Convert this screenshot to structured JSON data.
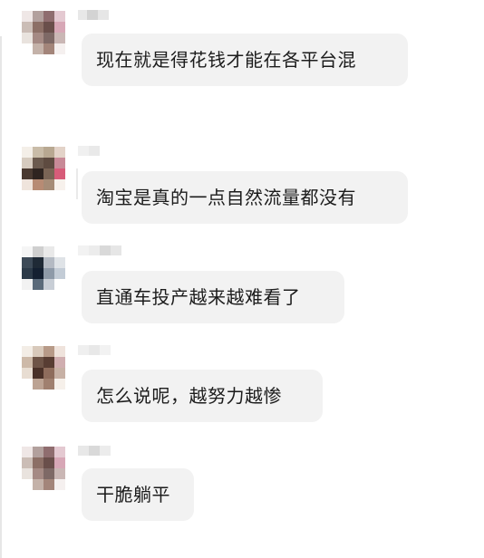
{
  "messages": [
    {
      "text": "现在就是得花钱才能在各平台混"
    },
    {
      "text": "淘宝是真的一点自然流量都没有"
    },
    {
      "text": "直通车投产越来越难看了"
    },
    {
      "text": "怎么说呢，越努力越惨"
    },
    {
      "text": "干脆躺平"
    }
  ],
  "colors": {
    "bubble_bg": "#f2f2f2",
    "text": "#1c1c1c",
    "background": "#ffffff"
  },
  "avatars": [
    {
      "icon": "pixelated-avatar-icon",
      "palette": [
        "#efe7e6",
        "#b2a09d",
        "#8f6d6f",
        "#e4c9d1",
        "#cbbdb6",
        "#8c6f66",
        "#6a4f4b",
        "#d7a7b6",
        "#e9e3de",
        "#a58a84",
        "#7e6966",
        "#cab7b5",
        "#ffffff",
        "#c4b2a9",
        "#a3857a",
        "#f5f0ef"
      ]
    },
    {
      "icon": "pixelated-avatar-icon",
      "palette": [
        "#f4efe8",
        "#c9bca8",
        "#b8a891",
        "#e3d3c8",
        "#d6cbbf",
        "#6b5a4e",
        "#5e4b40",
        "#c88a97",
        "#4a3a31",
        "#2f2420",
        "#7a6455",
        "#d75c79",
        "#efe4dc",
        "#b78b74",
        "#a68c77",
        "#f7f1ec"
      ]
    },
    {
      "icon": "pixelated-avatar-icon",
      "palette": [
        "#f5f5f5",
        "#cfcfcf",
        "#e9e9e9",
        "#ffffff",
        "#3d4a57",
        "#1f2a36",
        "#b4bac3",
        "#dfe3e7",
        "#2c3a48",
        "#142031",
        "#8e9aa8",
        "#c3ccd6",
        "#f2f2f2",
        "#5a6a7a",
        "#c8ced6",
        "#ffffff"
      ]
    },
    {
      "icon": "pixelated-avatar-icon",
      "palette": [
        "#f3ede6",
        "#d8c9bb",
        "#b79a88",
        "#efe3dc",
        "#cdb9a8",
        "#6e5447",
        "#583d33",
        "#d0aeb0",
        "#e8ddd2",
        "#4a3128",
        "#8e6c5c",
        "#c7b1a5",
        "#ffffff",
        "#bca393",
        "#a0806f",
        "#f6f0ea"
      ]
    },
    {
      "icon": "pixelated-avatar-icon",
      "palette": [
        "#efe7e6",
        "#b2a09d",
        "#8f6d6f",
        "#e4c9d1",
        "#cbbdb6",
        "#8c6f66",
        "#6a4f4b",
        "#d7a7b6",
        "#e9e3de",
        "#a58a84",
        "#7e6966",
        "#cab7b5",
        "#ffffff",
        "#c4b2a9",
        "#a3857a",
        "#f5f0ef"
      ]
    }
  ]
}
